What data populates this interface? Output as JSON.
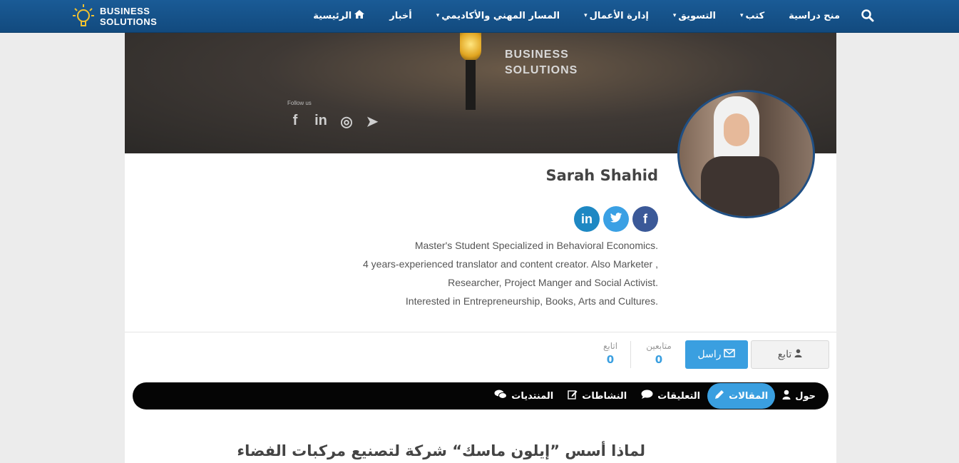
{
  "brand": {
    "line1": "BUSINESS",
    "line2": "SOLUTIONS"
  },
  "nav": {
    "items": [
      {
        "label": "الرئيسية",
        "icon": "home-icon",
        "dropdown": false
      },
      {
        "label": "أخبار",
        "dropdown": false
      },
      {
        "label": "المسار المهني والأكاديمي",
        "dropdown": true
      },
      {
        "label": "إدارة الأعمال",
        "dropdown": true
      },
      {
        "label": "التسويق",
        "dropdown": true
      },
      {
        "label": "كتب",
        "dropdown": true
      },
      {
        "label": "منح دراسية",
        "dropdown": false
      }
    ]
  },
  "cover": {
    "title_line1": "BUSINESS",
    "title_line2": "SOLUTIONS",
    "follow_label": "Follow us",
    "social": [
      "f",
      "in",
      "◎",
      "➤"
    ]
  },
  "profile": {
    "name": "Sarah Shahid",
    "social": {
      "linkedin": "in",
      "twitter": "t",
      "facebook": "f"
    },
    "bio": [
      "Master's Student Specialized in Behavioral Economics.",
      "4 years-experienced translator and content creator. Also Marketer ,",
      "Researcher, Project Manger and Social Activist.",
      "Interested in Entrepreneurship, Books, Arts and Cultures."
    ]
  },
  "actions": {
    "follow_label": "تابع",
    "message_label": "راسل"
  },
  "stats": {
    "followers": {
      "label": "متابعين",
      "value": "0"
    },
    "following": {
      "label": "اتابع",
      "value": "0"
    }
  },
  "tabs": [
    {
      "label": "حول",
      "icon": "user-icon",
      "active": false
    },
    {
      "label": "المقالات",
      "icon": "pencil-icon",
      "active": true
    },
    {
      "label": "التعليقات",
      "icon": "comment-icon",
      "active": false
    },
    {
      "label": "النشاطات",
      "icon": "edit-icon",
      "active": false
    },
    {
      "label": "المنتديات",
      "icon": "comments-icon",
      "active": false
    }
  ],
  "post": {
    "title": "لماذا أسس ”إيلون ماسك“ شركة لتصنيع مركبات الفضاء"
  },
  "colors": {
    "nav": "#1a5b96",
    "accent": "#3a9fe0",
    "tabs_bg": "#050505"
  }
}
